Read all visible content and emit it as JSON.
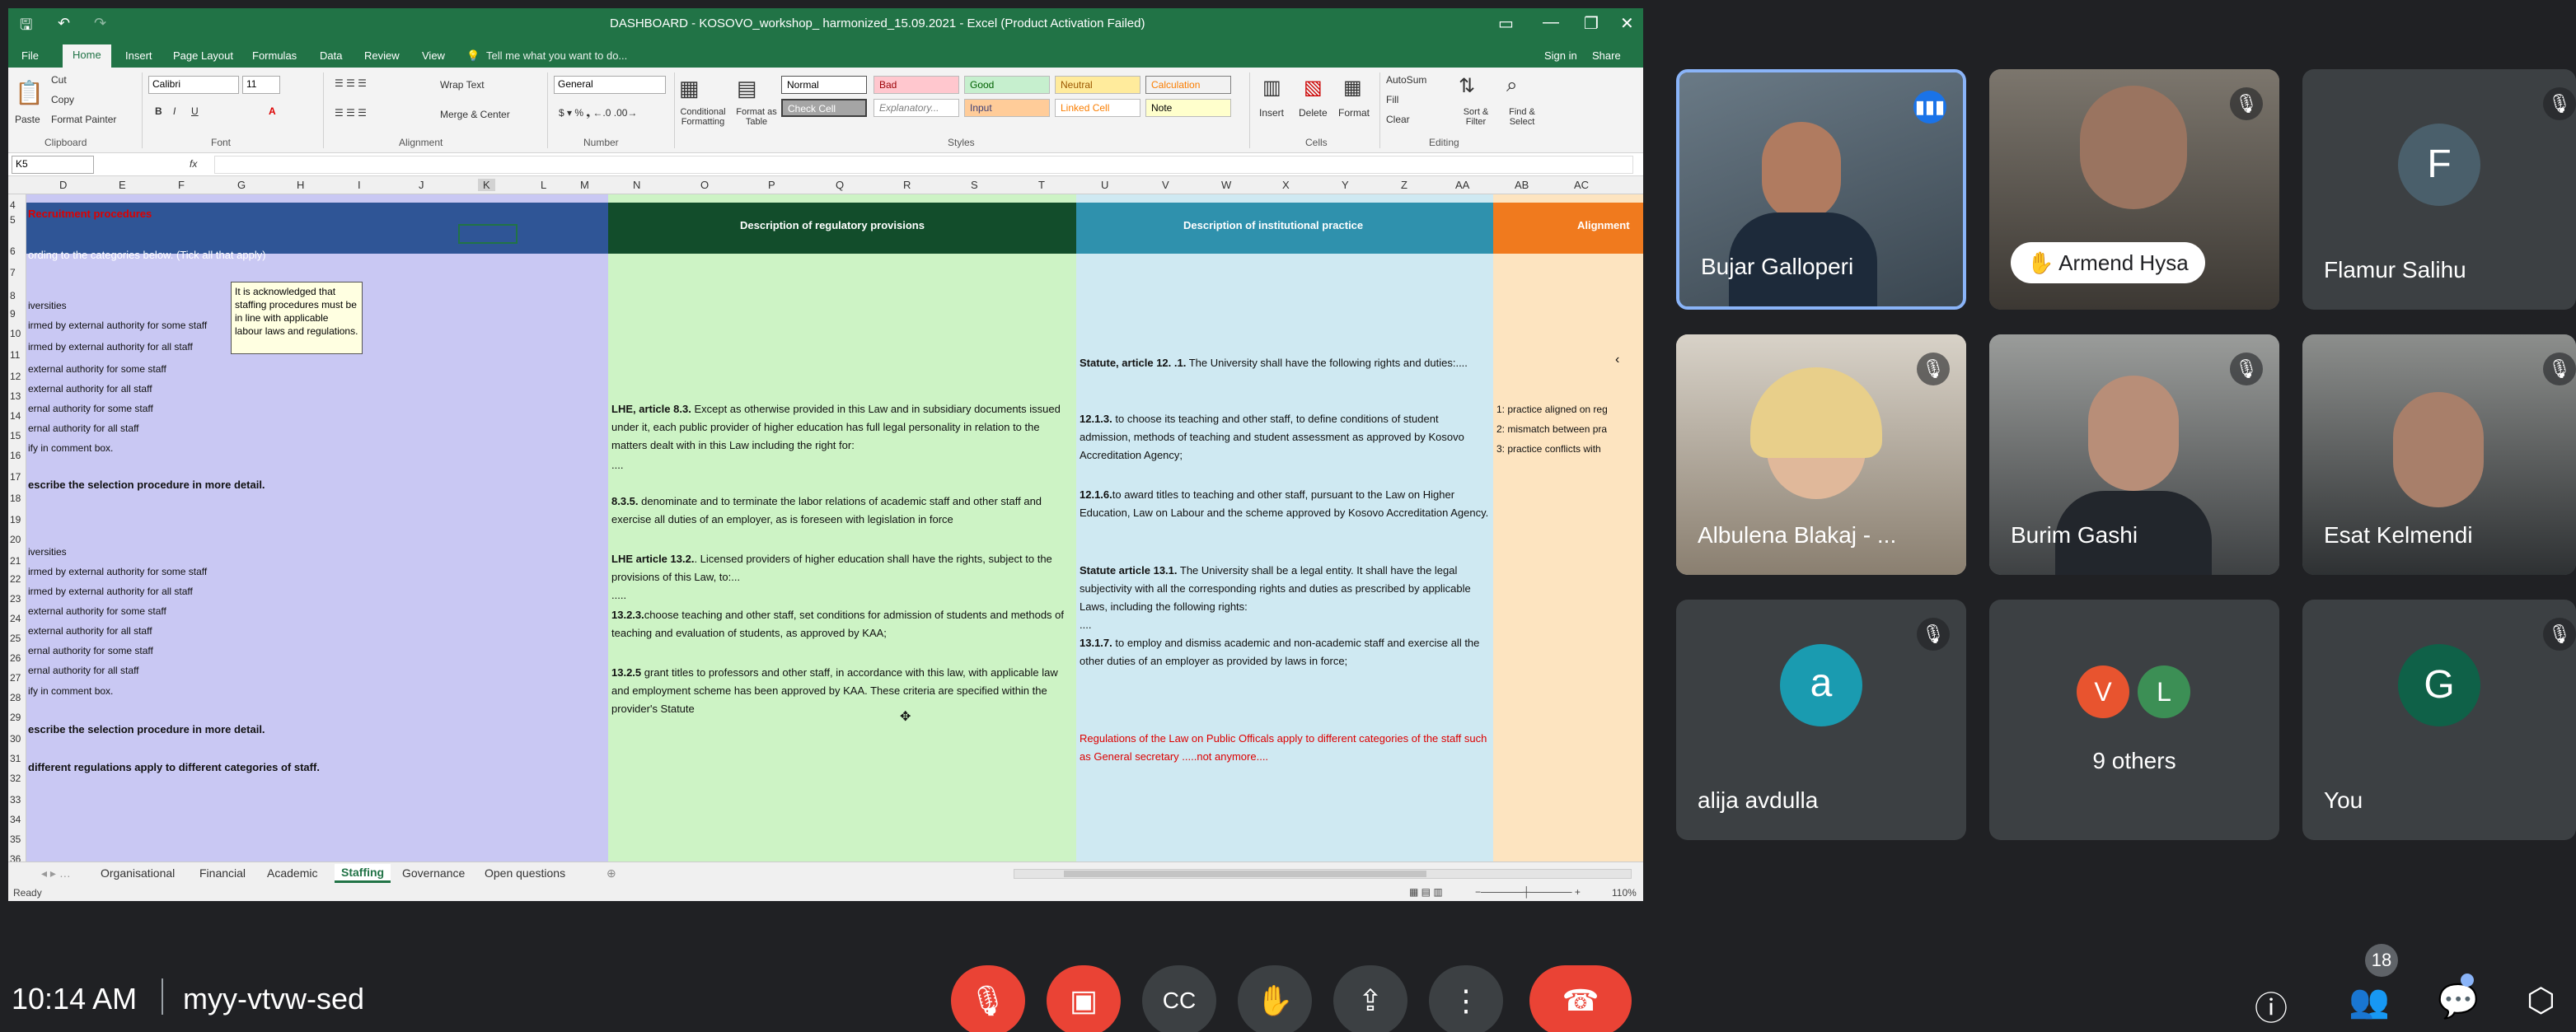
{
  "excel": {
    "title": "DASHBOARD - KOSOVO_workshop_ harmonized_15.09.2021 - Excel (Product Activation Failed)",
    "ribbon_tabs": [
      "File",
      "Home",
      "Insert",
      "Page Layout",
      "Formulas",
      "Data",
      "Review",
      "View"
    ],
    "tell_me": "Tell me what you want to do...",
    "signin": "Sign in",
    "share": "Share",
    "clipboard": {
      "cut": "Cut",
      "copy": "Copy",
      "paste": "Paste",
      "format_painter": "Format Painter",
      "group": "Clipboard"
    },
    "font": {
      "name": "Calibri",
      "size": "11",
      "group": "Font"
    },
    "alignment": {
      "wrap": "Wrap Text",
      "merge": "Merge & Center",
      "group": "Alignment"
    },
    "number": {
      "format": "General",
      "group": "Number"
    },
    "styles": {
      "cond": "Conditional Formatting",
      "table": "Format as Table",
      "normal": "Normal",
      "bad": "Bad",
      "good": "Good",
      "neutral": "Neutral",
      "calculation": "Calculation",
      "check": "Check Cell",
      "explanatory": "Explanatory...",
      "input": "Input",
      "linked": "Linked Cell",
      "note": "Note",
      "group": "Styles"
    },
    "cells": {
      "insert": "Insert",
      "delete": "Delete",
      "format": "Format",
      "group": "Cells"
    },
    "editing": {
      "autosum": "AutoSum",
      "fill": "Fill",
      "clear": "Clear",
      "sort": "Sort & Filter",
      "find": "Find & Select",
      "group": "Editing"
    },
    "namebox": "K5",
    "fx": "fx",
    "columns": [
      "D",
      "E",
      "F",
      "G",
      "H",
      "I",
      "J",
      "K",
      "L",
      "M",
      "N",
      "O",
      "P",
      "Q",
      "R",
      "S",
      "T",
      "U",
      "V",
      "W",
      "X",
      "Y",
      "Z",
      "AA",
      "AB",
      "AC"
    ],
    "rows": [
      "4",
      "5",
      "6",
      "7",
      "8",
      "9",
      "10",
      "11",
      "12",
      "13",
      "14",
      "15",
      "16",
      "17",
      "18",
      "19",
      "20",
      "21",
      "22",
      "23",
      "24",
      "25",
      "26",
      "27",
      "28",
      "29",
      "30",
      "31",
      "32",
      "33",
      "34",
      "35",
      "36",
      "37"
    ],
    "left_col": {
      "r4": "Recruitment procedures",
      "r6": "ording to the categories below. (Tick all that apply)",
      "items_a": [
        "iversities",
        "irmed by external authority for some staff",
        "irmed by external authority for all staff",
        "external authority for some staff",
        "external authority for all staff",
        "ernal authority for some staff",
        "ernal authority for all staff",
        "ify in comment box."
      ],
      "r18": "escribe the selection procedure in more detail.",
      "items_b": [
        "iversities",
        "irmed by external authority for some staff",
        "irmed by external authority for all staff",
        "external authority for some staff",
        "external authority for all staff",
        "ernal authority for some staff",
        "ernal authority for all staff",
        "ify in comment box."
      ],
      "r31": "escribe the selection procedure in more detail.",
      "r33": "different regulations apply to different categories of staff."
    },
    "comment": "It is acknowledged that staffing procedures must be in line with applicable labour laws and regulations.",
    "reg": {
      "header": "Description of regulatory provisions",
      "p1_b": "LHE, article 8.3.",
      "p1": "Except as otherwise provided in this Law and in subsidiary documents issued under it, each public provider of higher education has full legal personality in relation to the matters dealt with in this Law including the right for:",
      "dots1": "....",
      "p2_b": "8.3.5.",
      "p2": "denominate and to terminate the labor relations of academic staff and other staff and exercise all duties of an employer, as is foreseen with legislation in force",
      "p3_b": "LHE article 13.2.",
      "p3": ". Licensed providers of higher education shall have the rights, subject to the provisions of this Law, to:...",
      "dots2": ".....",
      "p4_b": "13.2.3.",
      "p4": "choose teaching and other staff, set conditions for admission of students and methods of teaching and evaluation of students, as approved by KAA;",
      "p5_b": "13.2.5",
      "p5": "grant titles to professors and other staff, in accordance with this law, with applicable law and employment scheme has been approved by KAA. These criteria are specified within the provider's Statute"
    },
    "inst": {
      "header": "Description of institutional practice",
      "p1_b": "Statute, article 12. .1.",
      "p1": "The University shall have the following rights and duties:....",
      "p2_b": "12.1.3.",
      "p2": "to choose its teaching and other staff, to define conditions of student admission, methods of teaching and student assessment as approved by Kosovo Accreditation Agency;",
      "p3_b": "12.1.6.",
      "p3": "to award titles to teaching and other staff, pursuant to the Law on Higher Education, Law on Labour and the scheme approved by Kosovo Accreditation Agency.",
      "p4_b": "Statute article 13.1.",
      "p4": "The University shall be a legal entity. It shall have the legal subjectivity with all the corresponding rights and duties as prescribed by applicable Laws, including the following rights:",
      "dots": "....",
      "p5_b": "13.1.7.",
      "p5": "to employ and dismiss academic and non-academic staff and exercise all the other duties of an employer as provided by laws in force;",
      "red": "Regulations of the Law on Public Officals apply to different categories of the staff such as General secretary .....not anymore...."
    },
    "align": {
      "header": "Alignment",
      "items": [
        "1: practice aligned on reg",
        "2: mismatch between pra",
        "3: practice conflicts with"
      ]
    },
    "sheets": [
      "Organisational",
      "Financial",
      "Academic",
      "Staffing",
      "Governance",
      "Open questions"
    ],
    "active_sheet": "Staffing",
    "status": "Ready",
    "zoom": "110%"
  },
  "participants": [
    {
      "name": "Bujar Galloperi",
      "speaking": true
    },
    {
      "name": "Armend Hysa",
      "hand": true
    },
    {
      "name": "Flamur Salihu",
      "initial": "F",
      "color": "#4a5f6b"
    },
    {
      "name": "Albulena Blakaj - ..."
    },
    {
      "name": "Burim Gashi"
    },
    {
      "name": "Esat Kelmendi"
    },
    {
      "name": "alija avdulla",
      "initial": "a",
      "color": "#1a9bb0"
    },
    {
      "name": "9 others",
      "initials": [
        "V",
        "L"
      ],
      "colors": [
        "#e8542f",
        "#3c8f55"
      ]
    },
    {
      "name": "You",
      "initial": "G",
      "color": "#0f6148"
    }
  ],
  "meeting": {
    "time": "10:14 AM",
    "code": "myy-vtvw-sed",
    "people_count": "18"
  }
}
